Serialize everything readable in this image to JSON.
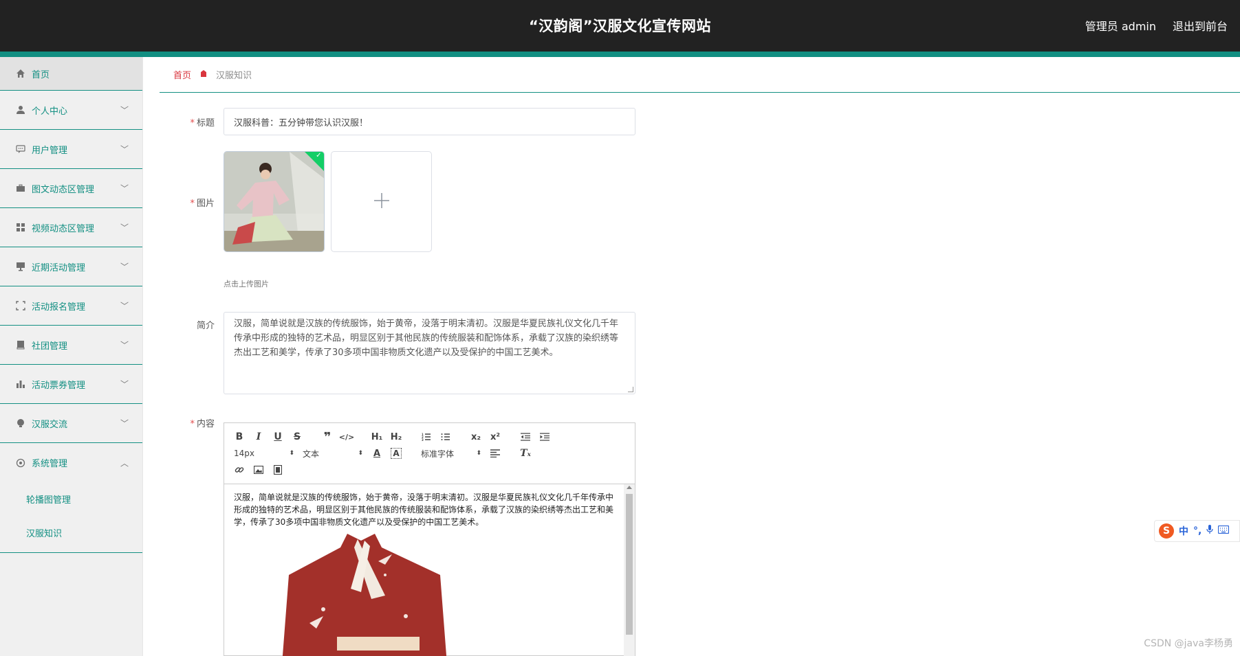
{
  "header": {
    "site_title": "“汉韵阁”汉服文化宣传网站",
    "admin_label": "管理员 admin",
    "exit_label": "退出到前台"
  },
  "colors": {
    "accent": "#128f82",
    "header_bg": "#222222",
    "required": "#e24c4c",
    "breadcrumb_home": "#d9363e"
  },
  "sidebar": {
    "items": [
      {
        "label": "首页",
        "icon": "home-icon"
      },
      {
        "label": "个人中心",
        "icon": "user-icon"
      },
      {
        "label": "用户管理",
        "icon": "chat-icon"
      },
      {
        "label": "图文动态区管理",
        "icon": "briefcase-icon"
      },
      {
        "label": "视频动态区管理",
        "icon": "grid-icon"
      },
      {
        "label": "近期活动管理",
        "icon": "monitor-icon"
      },
      {
        "label": "活动报名管理",
        "icon": "frame-icon"
      },
      {
        "label": "社团管理",
        "icon": "book-icon"
      },
      {
        "label": "活动票券管理",
        "icon": "bar-chart-icon"
      },
      {
        "label": "汉服交流",
        "icon": "bulb-icon"
      },
      {
        "label": "系统管理",
        "icon": "gear-icon"
      }
    ],
    "sub_items": [
      {
        "label": "轮播图管理"
      },
      {
        "label": "汉服知识"
      }
    ]
  },
  "breadcrumb": {
    "home": "首页",
    "current": "汉服知识"
  },
  "form": {
    "title_label": "标题",
    "title_value": "汉服科普：五分钟带您认识汉服！",
    "image_label": "图片",
    "upload_hint": "点击上传图片",
    "intro_label": "简介",
    "intro_value": "汉服，简单说就是汉族的传统服饰，始于黄帝，没落于明末清初。汉服是华夏民族礼仪文化几千年传承中形成的独特的艺术品，明显区别于其他民族的传统服装和配饰体系，承载了汉族的染织绣等杰出工艺和美学，传承了30多项中国非物质文化遗产以及受保护的中国工艺美术。",
    "content_label": "内容"
  },
  "editor": {
    "font_size": "14px",
    "block_type": "文本",
    "font_family": "标准字体",
    "body_text": "汉服，简单说就是汉族的传统服饰，始于黄帝，没落于明末清初。汉服是华夏民族礼仪文化几千年传承中形成的独特的艺术品，明显区别于其他民族的传统服装和配饰体系，承载了汉族的染织绣等杰出工艺和美学，传承了30多项中国非物质文化遗产以及受保护的中国工艺美术。"
  },
  "ime": {
    "mode": "中",
    "punct": "°,"
  },
  "watermark": "CSDN @java李杨勇"
}
